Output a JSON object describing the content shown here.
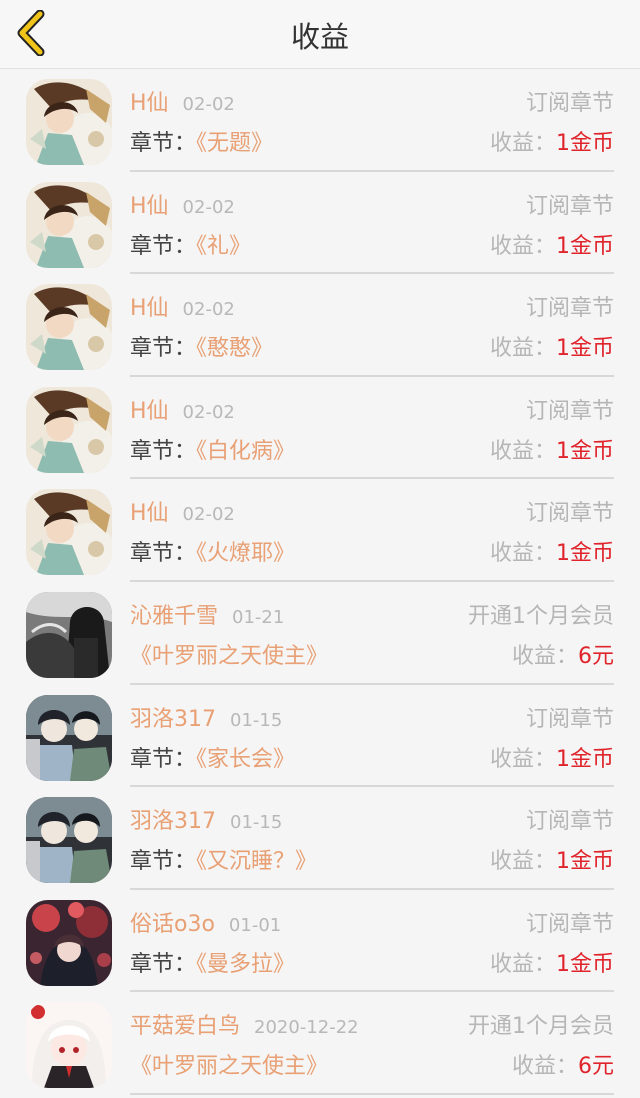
{
  "header": {
    "title": "收益",
    "back_icon": "chevron-left-icon",
    "accent": "#f0c419"
  },
  "colors": {
    "name": "#e8a074",
    "amount": "#e0242c",
    "muted": "#b6b6b6"
  },
  "earnings_label": "收益：",
  "chapter_label": "章节：",
  "rows": [
    {
      "avatar": "avatar-a",
      "name": "H仙",
      "date": "02-02",
      "type": "订阅章节",
      "chapter": "《无题》",
      "amount": "1金币",
      "has_label": true
    },
    {
      "avatar": "avatar-a",
      "name": "H仙",
      "date": "02-02",
      "type": "订阅章节",
      "chapter": "《礼》",
      "amount": "1金币",
      "has_label": true
    },
    {
      "avatar": "avatar-a",
      "name": "H仙",
      "date": "02-02",
      "type": "订阅章节",
      "chapter": "《憨憨》",
      "amount": "1金币",
      "has_label": true
    },
    {
      "avatar": "avatar-a",
      "name": "H仙",
      "date": "02-02",
      "type": "订阅章节",
      "chapter": "《白化病》",
      "amount": "1金币",
      "has_label": true
    },
    {
      "avatar": "avatar-a",
      "name": "H仙",
      "date": "02-02",
      "type": "订阅章节",
      "chapter": "《火燎耶》",
      "amount": "1金币",
      "has_label": true
    },
    {
      "avatar": "avatar-b",
      "name": "沁雅千雪",
      "date": "01-21",
      "type": "开通1个月会员",
      "chapter": "《叶罗丽之天使主》",
      "amount": "6元",
      "has_label": false
    },
    {
      "avatar": "avatar-c",
      "name": "羽洛317",
      "date": "01-15",
      "type": "订阅章节",
      "chapter": "《家长会》",
      "amount": "1金币",
      "has_label": true
    },
    {
      "avatar": "avatar-c",
      "name": "羽洛317",
      "date": "01-15",
      "type": "订阅章节",
      "chapter": "《又沉睡？》",
      "amount": "1金币",
      "has_label": true
    },
    {
      "avatar": "avatar-d",
      "name": "俗话o3o",
      "date": "01-01",
      "type": "订阅章节",
      "chapter": "《曼多拉》",
      "amount": "1金币",
      "has_label": true
    },
    {
      "avatar": "avatar-e",
      "name": "平菇爱白鸟",
      "date": "2020-12-22",
      "type": "开通1个月会员",
      "chapter": "《叶罗丽之天使主》",
      "amount": "6元",
      "has_label": false
    }
  ]
}
